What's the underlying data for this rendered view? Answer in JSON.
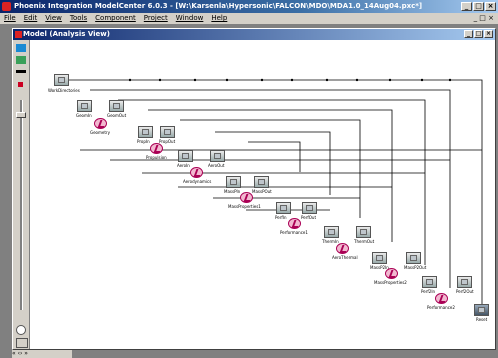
{
  "window": {
    "title": "Phoenix Integration ModelCenter 6.0.3 - [W:\\Karsenla\\Hypersonic\\FALCON\\MDO\\MDA1.0_14Aug04.pxc*]",
    "buttons": [
      "_",
      "□",
      "×"
    ]
  },
  "menu": {
    "items": [
      "File",
      "Edit",
      "View",
      "Tools",
      "Component",
      "Project",
      "Window",
      "Help"
    ],
    "right": "_ □ ×"
  },
  "model_window": {
    "title": "Model (Analysis View)",
    "buttons": [
      "_",
      "□",
      "×"
    ]
  },
  "components": [
    {
      "label": "WorkDirectories",
      "kind": "node"
    },
    {
      "label": "Geometry",
      "kind": "node"
    },
    {
      "label": "Geometry",
      "kind": "condition"
    },
    {
      "label": "Propulsion",
      "kind": "node"
    },
    {
      "label": "Propulsion",
      "kind": "condition"
    },
    {
      "label": "Aerodynamics",
      "kind": "node"
    },
    {
      "label": "Aerodynamics",
      "kind": "condition"
    },
    {
      "label": "MassProperties1",
      "kind": "node"
    },
    {
      "label": "MassProperties1",
      "kind": "condition"
    },
    {
      "label": "Performance1",
      "kind": "node"
    },
    {
      "label": "Performance1",
      "kind": "condition"
    },
    {
      "label": "AeroThermal",
      "kind": "node"
    },
    {
      "label": "AeroThermal",
      "kind": "condition"
    },
    {
      "label": "MassProperties2",
      "kind": "node"
    },
    {
      "label": "MassProperties2",
      "kind": "condition"
    },
    {
      "label": "Performance2",
      "kind": "node"
    },
    {
      "label": "Performance2",
      "kind": "condition"
    },
    {
      "label": "Reset",
      "kind": "output"
    }
  ],
  "node_captions": [
    "WorkDirectories",
    "GeomIn",
    "GeomOut",
    "PropIn",
    "PropOut",
    "AeroIn",
    "AeroOut",
    "MassPIn",
    "MassPOut",
    "PerfIn",
    "PerfOut",
    "ThermIn",
    "ThermOut",
    "MassP2In",
    "MassP2Out",
    "Perf2In",
    "Perf2Out",
    "Reset"
  ],
  "status": {
    "tabs": "« ‹› »"
  }
}
